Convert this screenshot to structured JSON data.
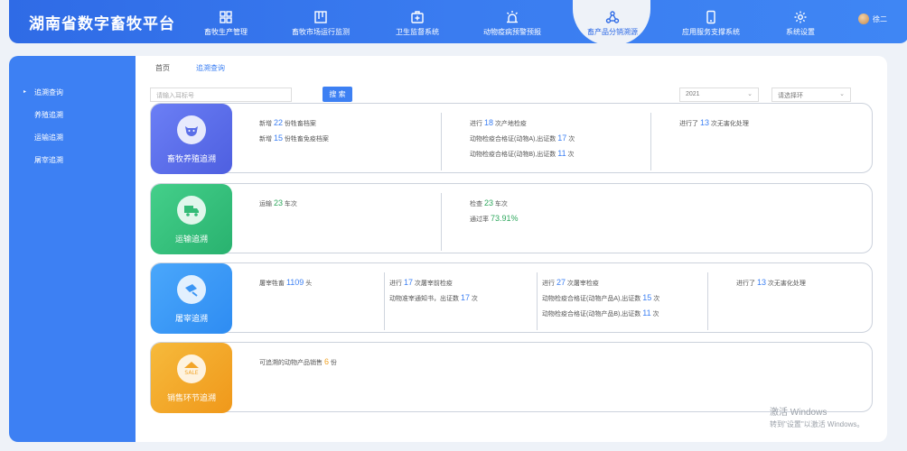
{
  "header": {
    "brand": "湖南省数字畜牧平台",
    "nav": [
      {
        "label": "畜牧生产管理",
        "icon": "grid-icon"
      },
      {
        "label": "畜牧市场运行监测",
        "icon": "board-icon"
      },
      {
        "label": "卫生监督系统",
        "icon": "medkit-icon"
      },
      {
        "label": "动物疫病预警预报",
        "icon": "alarm-icon"
      },
      {
        "label": "畜产品分销溯源",
        "icon": "network-icon",
        "active": true
      },
      {
        "label": "应用服务支撑系统",
        "icon": "phone-icon"
      },
      {
        "label": "系统设置",
        "icon": "gear-icon"
      }
    ],
    "user": "徐二"
  },
  "sidebar": {
    "items": [
      {
        "label": "追溯查询",
        "active": true
      },
      {
        "label": "养殖追溯"
      },
      {
        "label": "运输追溯"
      },
      {
        "label": "屠宰追溯"
      }
    ]
  },
  "breadcrumb": {
    "home": "首页",
    "current": "追溯查询"
  },
  "search": {
    "placeholder": "请输入耳标号",
    "button": "搜 索",
    "year": "2021",
    "step_placeholder": "请选择环"
  },
  "cards": {
    "breeding": {
      "title": "畜牧养殖追溯",
      "c1": {
        "l1_pre": "新增",
        "l1_num": "22",
        "l1_post": "份牲畜档案",
        "l2_pre": "新增",
        "l2_num": "15",
        "l2_post": "份牲畜免疫档案"
      },
      "c2": {
        "l1_pre": "进行",
        "l1_num": "18",
        "l1_post": "次产地检疫",
        "l2_pre": "动物检疫合格证(动物A),出证数",
        "l2_num": "17",
        "l2_post": "次",
        "l3_pre": "动物检疫合格证(动物B),出证数",
        "l3_num": "11",
        "l3_post": "次"
      },
      "c3": {
        "l1_pre": "进行了",
        "l1_num": "13",
        "l1_post": "次无害化处理"
      }
    },
    "transport": {
      "title": "运输追溯",
      "c1": {
        "l1_pre": "运输",
        "l1_num": "23",
        "l1_post": "车次"
      },
      "c2": {
        "l1_pre": "检查",
        "l1_num": "23",
        "l1_post": "车次",
        "l2_pre": "通过率",
        "l2_num": "73.91%"
      }
    },
    "slaughter": {
      "title": "屠宰追溯",
      "c1": {
        "l1_pre": "屠宰牲畜",
        "l1_num": "1109",
        "l1_post": "头"
      },
      "c2": {
        "l1_pre": "进行",
        "l1_num": "17",
        "l1_post": "次屠宰前检疫",
        "l2_pre": "动物准宰通知书，出证数",
        "l2_num": "17",
        "l2_post": "次"
      },
      "c3": {
        "l1_pre": "进行",
        "l1_num": "27",
        "l1_post": "次屠宰检疫",
        "l2_pre": "动物检疫合格证(动物产品A),出证数",
        "l2_num": "15",
        "l2_post": "次",
        "l3_pre": "动物检疫合格证(动物产品B),出证数",
        "l3_num": "11",
        "l3_post": "次"
      },
      "c4": {
        "l1_pre": "进行了",
        "l1_num": "13",
        "l1_post": "次无害化处理"
      }
    },
    "sales": {
      "title": "销售环节追溯",
      "icon_text": "SALE",
      "c1": {
        "l1_pre": "可追溯的动物产品销售",
        "l1_num": "6",
        "l1_post": "份"
      }
    }
  },
  "watermark": {
    "line1": "激活 Windows",
    "line2": "转到\"设置\"以激活 Windows。"
  }
}
